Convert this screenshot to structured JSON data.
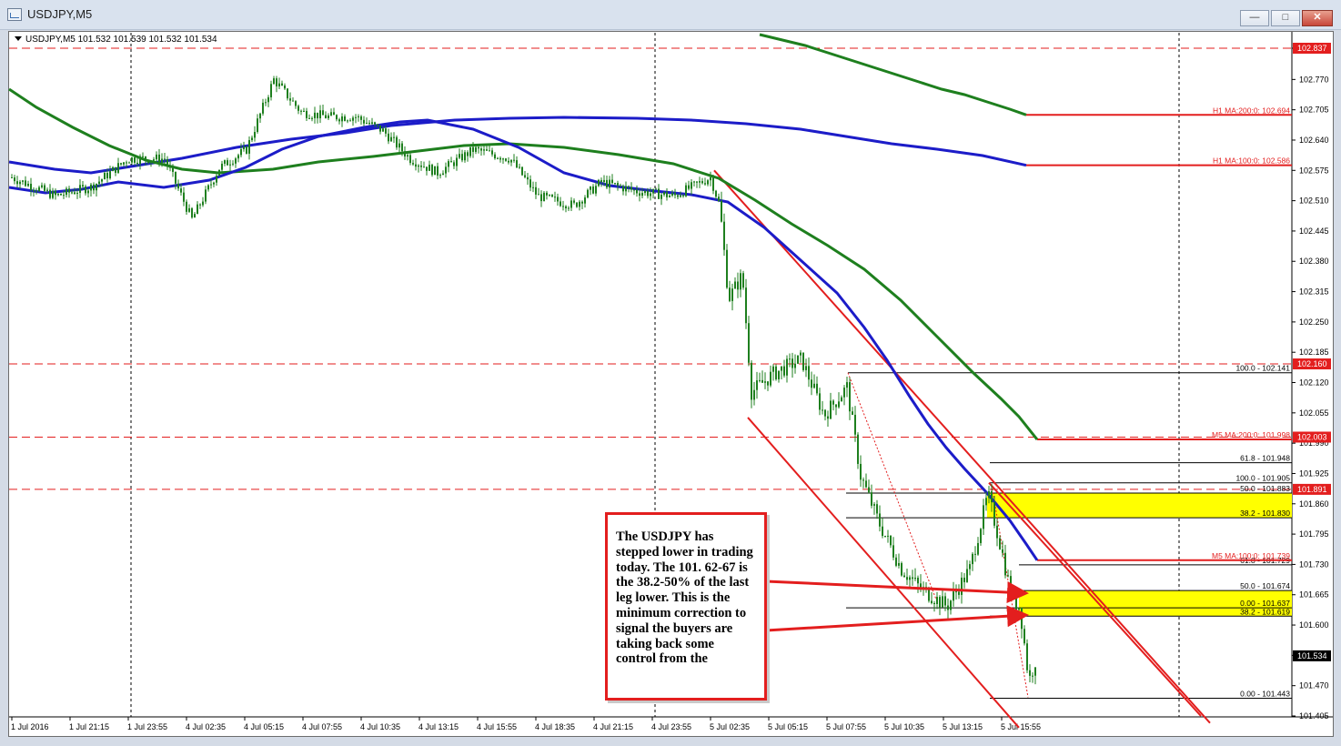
{
  "window": {
    "title": "USDJPY,M5",
    "buttons": {
      "minimize": "—",
      "maximize": "□",
      "close": "✕"
    }
  },
  "chart": {
    "symbol_line": "USDJPY,M5  101.532 101.539 101.532 101.534",
    "price_axis": [
      "102.837",
      "102.770",
      "102.705",
      "102.640",
      "102.575",
      "102.510",
      "102.445",
      "102.380",
      "102.315",
      "102.250",
      "102.185",
      "102.120",
      "102.055",
      "101.990",
      "101.925",
      "101.860",
      "101.795",
      "101.730",
      "101.665",
      "101.600",
      "101.535",
      "101.470",
      "101.405"
    ],
    "highlighted_prices": [
      {
        "value": "102.837",
        "color": "#e31e1e"
      },
      {
        "value": "102.160",
        "color": "#e31e1e"
      },
      {
        "value": "102.003",
        "color": "#e31e1e"
      },
      {
        "value": "101.891",
        "color": "#e31e1e"
      },
      {
        "value": "101.534",
        "color": "#000000"
      }
    ],
    "time_axis": [
      "1 Jul 2016",
      "1 Jul 21:15",
      "1 Jul 23:55",
      "4 Jul 02:35",
      "4 Jul 05:15",
      "4 Jul 07:55",
      "4 Jul 10:35",
      "4 Jul 13:15",
      "4 Jul 15:55",
      "4 Jul 18:35",
      "4 Jul 21:15",
      "4 Jul 23:55",
      "5 Jul 02:35",
      "5 Jul 05:15",
      "5 Jul 07:55",
      "5 Jul 10:35",
      "5 Jul 13:15",
      "5 Jul 15:55"
    ],
    "ma_labels": [
      {
        "text": "H1 MA:200:0: 102.694"
      },
      {
        "text": "H1 MA:100:0: 102.586"
      },
      {
        "text": "M5 MA:200:0: 101.998"
      },
      {
        "text": "M5 MA:100:0: 101.739"
      }
    ],
    "fib_labels": [
      {
        "text": "100.0 - 102.141"
      },
      {
        "text": "61.8 - 101.948"
      },
      {
        "text": "100.0 - 101.905"
      },
      {
        "text": "50.0 - 101.883"
      },
      {
        "text": "38.2 - 101.830"
      },
      {
        "text": "61.8 - 101.729"
      },
      {
        "text": "50.0 - 101.674"
      },
      {
        "text": "0.00 - 101.637"
      },
      {
        "text": "38.2 - 101.619"
      },
      {
        "text": "0.00 - 101.443"
      }
    ],
    "colors": {
      "ma_green": "#1e7f1e",
      "ma_blue": "#1c1cc8",
      "drawing_red": "#e31e1e",
      "highlight_yellow": "#ffff00"
    }
  },
  "annotation": {
    "text": "The USDJPY has stepped lower in trading today. The 101. 62-67 is the 38.2-50% of the last leg lower. This is the minimum correction to signal the buyers are taking back some control from the"
  }
}
